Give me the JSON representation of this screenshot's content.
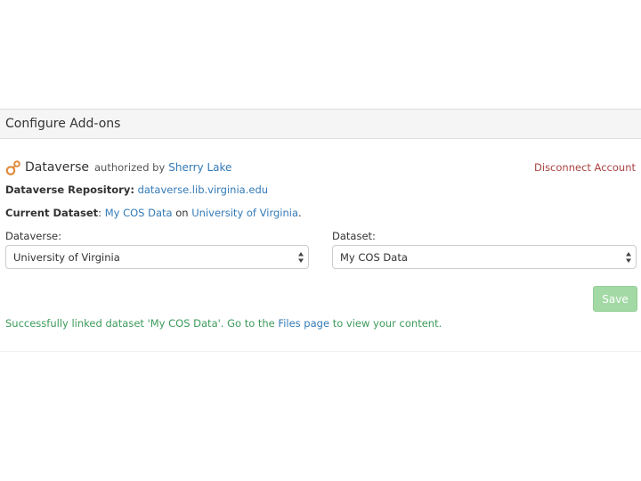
{
  "panel": {
    "title": "Configure Add-ons"
  },
  "addon": {
    "icon": "dataverse-logo-icon",
    "name": "Dataverse",
    "authorized_by": "authorized by",
    "user": "Sherry Lake",
    "disconnect_label": "Disconnect Account"
  },
  "repository": {
    "label": "Dataverse Repository:",
    "value": "dataverse.lib.virginia.edu"
  },
  "current_dataset": {
    "label": "Current Dataset",
    "colon": ":",
    "dataset": "My COS Data",
    "on": "on",
    "dataverse": "University of Virginia",
    "period": "."
  },
  "fields": {
    "dataverse_label": "Dataverse:",
    "dataverse_value": "University of Virginia",
    "dataset_label": "Dataset:",
    "dataset_value": "My COS Data"
  },
  "save_label": "Save",
  "message": {
    "part1": "Successfully linked dataset 'My COS Data'. Go to the ",
    "link": "Files page",
    "part2": " to view your content."
  },
  "colors": {
    "link": "#337ab7",
    "danger": "#a94442",
    "success": "#3c9a5a",
    "save_bg": "#a3d9a5",
    "logo": "#e08a3c"
  }
}
